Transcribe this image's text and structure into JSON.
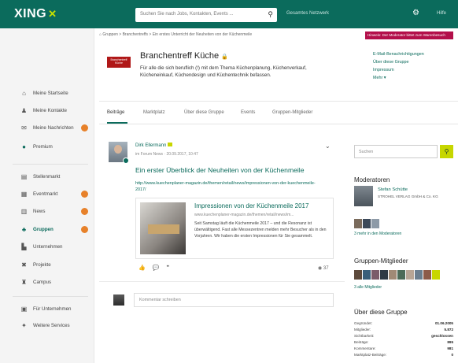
{
  "header": {
    "logo": "XING",
    "search_placeholder": "Suchen Sie nach Jobs, Kontakten, Events ...",
    "search_scope": "Gesamtes Netzwerk",
    "help": "Hilfe"
  },
  "sidebar": {
    "items": [
      {
        "label": "Meine Startseite"
      },
      {
        "label": "Meine Kontakte"
      },
      {
        "label": "Meine Nachrichten"
      },
      {
        "label": "Premium"
      },
      {
        "label": "Stellenmarkt"
      },
      {
        "label": "Eventmarkt"
      },
      {
        "label": "News"
      },
      {
        "label": "Gruppen"
      },
      {
        "label": "Unternehmen"
      },
      {
        "label": "Projekte"
      },
      {
        "label": "Campus"
      },
      {
        "label": "Für Unternehmen"
      },
      {
        "label": "Weitere Services"
      }
    ]
  },
  "breadcrumb": "Gruppen > Branchentreffs > Ein erstes Unterricht der Neuheiten von der Küchenmeile",
  "promo": "Hinweis: Der Moderator bittet zum Warenbesuch",
  "group": {
    "logo_text": "Branchentreff Küche",
    "title": "Branchentreff Küche",
    "description": "Für alle die sich beruflich (!) mit dem Thema Küchenplanung, Küchenverkauf, Kücheneinkauf, Küchendesign und Küchentechnik befassen.",
    "links": [
      "E-Mail-Benachrichtigungen",
      "Über diese Gruppe",
      "Impressum",
      "Mehr ▾"
    ]
  },
  "tabs": [
    "Beiträge",
    "Marktplatz",
    "Über diese Gruppe",
    "Events",
    "Gruppen-Mitglieder"
  ],
  "post": {
    "author": "Dirk Ellermann",
    "meta": "im Forum News · 20.09.2017, 10:47",
    "title": "Ein erster Überblick der Neuheiten von der Küchenmeile",
    "link": "http://www.kuechenplaner-magazin.de/themen/retail/news/impressionen-von-der-kuechenmeile-2017/",
    "preview_title": "Impressionen von der Küchenmeile 2017",
    "preview_url": "www.kuechenplaner-magazin.de/themen/retail/news/im...",
    "preview_text": "Seit Samstag läuft die Küchenmeile 2017 – und die Resonanz ist überwältigend. Fast alle Messezentren melden mehr Besucher als in den Vorjahren. Wir haben die ersten Impressionen für Sie gesammelt.",
    "views": "37"
  },
  "comment_placeholder": "Kommentar schreiben",
  "right": {
    "search_placeholder": "Suchen",
    "moderators_title": "Moderatoren",
    "moderator_name": "Stefan Schütte",
    "moderator_company": "STROHEL VERLAG GmbH & Co. KG",
    "moderators_link": "3 mehr in den Moderatoren",
    "members_title": "Gruppen-Mitglieder",
    "members_link": "3 alle Mitglieder",
    "about_title": "Über diese Gruppe",
    "about_rows": [
      {
        "label": "Gegründet:",
        "value": "01.06.2005"
      },
      {
        "label": "Mitglieder:",
        "value": "5.872"
      },
      {
        "label": "Sichtbarkeit:",
        "value": "geschlossen"
      },
      {
        "label": "Beiträge:",
        "value": "895"
      },
      {
        "label": "Kommentare:",
        "value": "981"
      },
      {
        "label": "Marktplatz-Beiträge:",
        "value": "0"
      }
    ]
  },
  "colors": {
    "brand": "#0b6b5c",
    "accent": "#c6d600",
    "badge": "#e7812a",
    "promo": "#b30f4a"
  }
}
